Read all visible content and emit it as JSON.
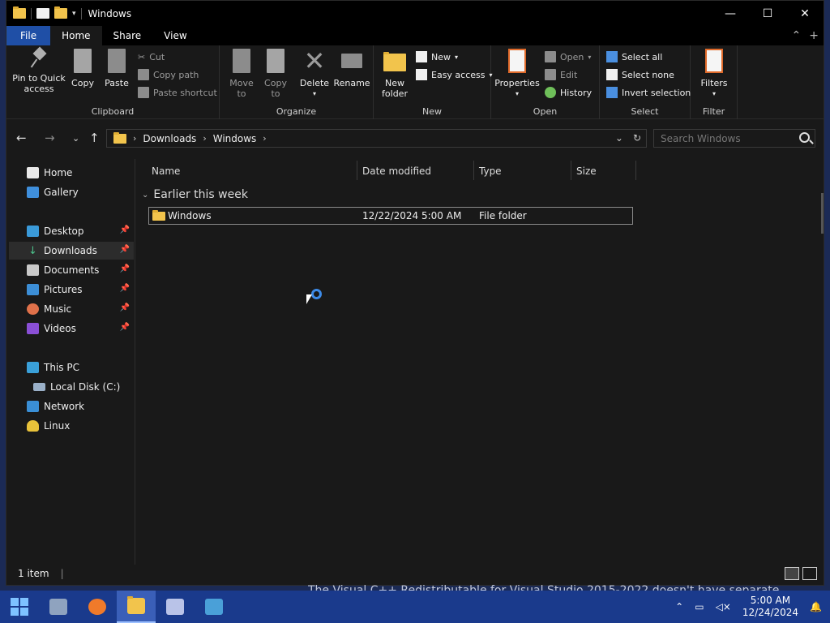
{
  "window": {
    "title": "Windows",
    "caption_minimize": "—",
    "caption_maximize": "☐",
    "caption_close": "✕"
  },
  "ribbon_tabs": {
    "file": "File",
    "home": "Home",
    "share": "Share",
    "view": "View"
  },
  "ribbon": {
    "clipboard": {
      "label": "Clipboard",
      "pin_l1": "Pin to Quick",
      "pin_l2": "access",
      "copy": "Copy",
      "paste": "Paste",
      "cut": "Cut",
      "copy_path": "Copy path",
      "paste_shortcut": "Paste shortcut"
    },
    "organize": {
      "label": "Organize",
      "move_l1": "Move",
      "move_l2": "to",
      "copy_l1": "Copy",
      "copy_l2": "to",
      "delete": "Delete",
      "rename": "Rename"
    },
    "new": {
      "label": "New",
      "folder_l1": "New",
      "folder_l2": "folder",
      "new_item": "New",
      "easy_access": "Easy access"
    },
    "open": {
      "label": "Open",
      "properties": "Properties",
      "open": "Open",
      "edit": "Edit",
      "history": "History"
    },
    "select": {
      "label": "Select",
      "select_all": "Select all",
      "select_none": "Select none",
      "invert": "Invert selection"
    },
    "filter": {
      "label": "Filter",
      "filters": "Filters"
    }
  },
  "address": {
    "segments": [
      "Downloads",
      "Windows"
    ]
  },
  "search": {
    "placeholder": "Search Windows"
  },
  "nav": {
    "home": "Home",
    "gallery": "Gallery",
    "desktop": "Desktop",
    "downloads": "Downloads",
    "documents": "Documents",
    "pictures": "Pictures",
    "music": "Music",
    "videos": "Videos",
    "this_pc": "This PC",
    "local_disk": "Local Disk (C:)",
    "network": "Network",
    "linux": "Linux"
  },
  "columns": {
    "name": "Name",
    "date_modified": "Date modified",
    "type": "Type",
    "size": "Size"
  },
  "group": {
    "title": "Earlier this week"
  },
  "files": [
    {
      "name": "Windows",
      "date": "12/22/2024 5:00 AM",
      "type": "File folder",
      "size": ""
    }
  ],
  "status": {
    "count": "1 item"
  },
  "background_caption": "The Visual C++ Redistributable for Visual Studio 2015-2022 doesn't have separate",
  "taskbar": {
    "time": "5:00 AM",
    "date": "12/24/2024"
  },
  "colors": {
    "accent": "#1f4fa6",
    "taskbar": "#1a3a8c",
    "folder": "#f2c44c"
  }
}
